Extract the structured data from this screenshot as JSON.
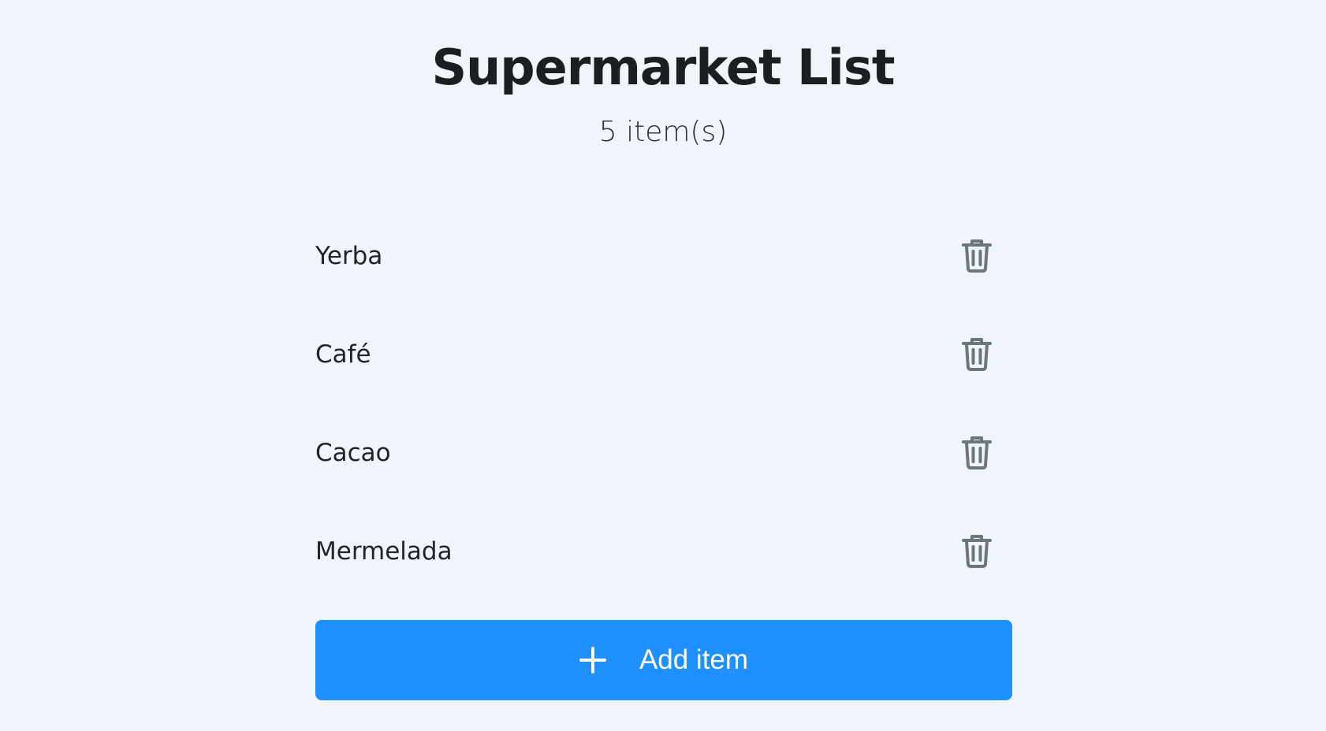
{
  "header": {
    "title": "Supermarket List",
    "count_text": "5 item(s)"
  },
  "items": [
    {
      "label": "Yerba",
      "action_icon": "trash-icon"
    },
    {
      "label": "Café",
      "action_icon": "trash-icon"
    },
    {
      "label": "Cacao",
      "action_icon": "trash-icon"
    },
    {
      "label": "Mermelada",
      "action_icon": "trash-icon"
    }
  ],
  "add_button": {
    "label": "Add item",
    "icon": "plus-icon"
  },
  "colors": {
    "background": "#f0f5fb",
    "accent": "#1e90ff",
    "icon": "#6c757d",
    "text": "#212529"
  }
}
